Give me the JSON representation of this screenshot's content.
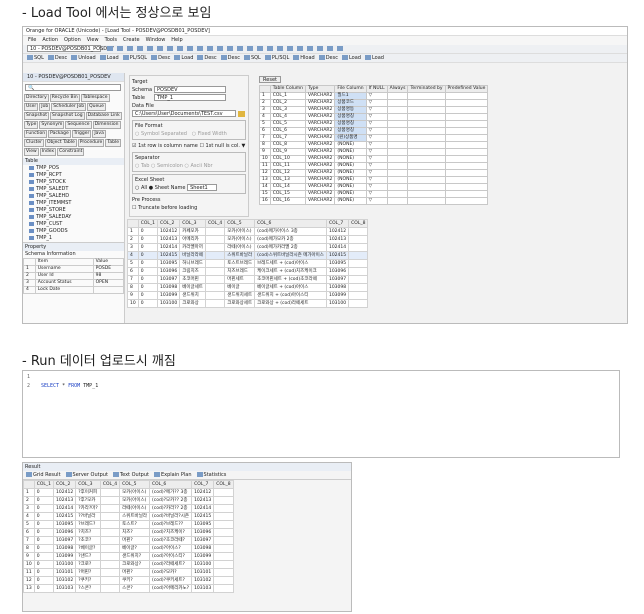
{
  "heading1": "- Load Tool 에서는 정상으로 보임",
  "heading2": "- Run 데이터 업로드시 깨짐",
  "app": {
    "title": "Orange for ORACLE (Unicode) - [Load Tool - POSDEV@POSDB01_POSDEV]",
    "menus": [
      "File",
      "Action",
      "Option",
      "View",
      "Tools",
      "Create",
      "Window",
      "Help"
    ],
    "connection": "10 - POSDEV@POSDB01_POSDEV",
    "toolbar_buttons": [
      "SQL",
      "Desc",
      "Unload",
      "Load",
      "PL/SQL",
      "Desc",
      "Load",
      "Desc",
      "Desc",
      "SQL",
      "PL/SQL",
      "Hload",
      "Desc",
      "Load",
      "Load"
    ],
    "conn_tab": "10 - POSDEV@POSDB01_POSDEV"
  },
  "browser": {
    "tabs": [
      "Directory",
      "Recycle Bin",
      "Tablespace",
      "User",
      "Job",
      "Scheduler Job",
      "Queue",
      "Snapshot",
      "Snapshot Log",
      "Database Link",
      "Type",
      "Synonym",
      "Sequence",
      "Dimension",
      "Function",
      "Package",
      "Trigger",
      "Java",
      "Cluster",
      "Object Table",
      "Procedure",
      "Table",
      "View",
      "Index",
      "Constraint"
    ],
    "section": "Table",
    "tree": [
      "TMP_POS",
      "TMP_RCPT",
      "TMP_STOCK",
      "TMP_SALEDT",
      "TMP_SALEHD",
      "TMP_ITEMMST",
      "TMP_STORE",
      "TMP_SALEDAY",
      "TMP_CUST",
      "TMP_GOODS",
      "TMP_1"
    ]
  },
  "property": {
    "title": "Property",
    "tab": "Schema Information",
    "headers": [
      "Item",
      "Value"
    ],
    "rows": [
      [
        "1",
        "Username",
        "POSDE"
      ],
      [
        "2",
        "User Id",
        "98"
      ],
      [
        "3",
        "Account Status",
        "OPEN"
      ],
      [
        "4",
        "Lock Date",
        ""
      ]
    ]
  },
  "load": {
    "target_label": "Target",
    "schema_label": "Schema",
    "schema_value": "POSDEV",
    "table_label": "Table",
    "table_value": "TMP_1",
    "datafile_label": "Data File",
    "datafile_value": "C:\\Users\\User\\Documents\\TEST.csv",
    "fileformat_label": "File Format",
    "delimited": "Symbol Separated",
    "fixed": "Fixed Width",
    "firstrow": "1st row is column name",
    "trailing": "1st null is col. ▼",
    "separator_label": "Separator",
    "sep_tab": "Tab",
    "sep_semicolon": "Semicolon",
    "sep_other": "Ascii Nbr",
    "excel_label": "Excel Sheet",
    "all": "All",
    "sheetname_label": "Sheet Name",
    "sheet_value": "Sheet1",
    "preproc_label": "Pre Process",
    "truncate": "Truncate before loading",
    "reset": "Reset"
  },
  "mapping": {
    "headers": [
      "",
      "Table Column",
      "Type",
      "File Column",
      "If NULL",
      "Always",
      "Terminated by",
      "Predefined Value"
    ],
    "rows": [
      [
        "1",
        "COL_1",
        "VARCHAR2",
        "필드1",
        "▽"
      ],
      [
        "2",
        "COL_2",
        "VARCHAR2",
        "상품코드",
        "▽"
      ],
      [
        "3",
        "COL_3",
        "VARCHAR2",
        "상품명등",
        "▽"
      ],
      [
        "4",
        "COL_4",
        "VARCHAR2",
        "상품명칭",
        "▽"
      ],
      [
        "5",
        "COL_5",
        "VARCHAR2",
        "상품명칭",
        "▽"
      ],
      [
        "6",
        "COL_6",
        "VARCHAR2",
        "상품명칭",
        "▽"
      ],
      [
        "7",
        "COL_7",
        "VARCHAR2",
        "(원)상품명",
        "▽"
      ],
      [
        "8",
        "COL_8",
        "VARCHAR2",
        "(NONE)",
        "▽"
      ],
      [
        "9",
        "COL_9",
        "VARCHAR2",
        "(NONE)",
        "▽"
      ],
      [
        "10",
        "COL_10",
        "VARCHAR2",
        "(NONE)",
        "▽"
      ],
      [
        "11",
        "COL_11",
        "VARCHAR2",
        "(NONE)",
        "▽"
      ],
      [
        "12",
        "COL_12",
        "VARCHAR2",
        "(NONE)",
        "▽"
      ],
      [
        "13",
        "COL_13",
        "VARCHAR2",
        "(NONE)",
        "▽"
      ],
      [
        "14",
        "COL_14",
        "VARCHAR2",
        "(NONE)",
        "▽"
      ],
      [
        "15",
        "COL_15",
        "VARCHAR2",
        "(NONE)",
        "▽"
      ],
      [
        "16",
        "COL_16",
        "VARCHAR2",
        "(NONE)",
        "▽"
      ]
    ]
  },
  "preview": {
    "headers": [
      "",
      "COL_1",
      "COL_2",
      "COL_3",
      "COL_4",
      "COL_5",
      "COL_6",
      "COL_7",
      "COL_8"
    ],
    "rows": [
      [
        "1",
        "0",
        "102412",
        "카페모카",
        "",
        "모카(아이스)",
        "(cod)메가아이스 3종",
        "102412",
        ""
      ],
      [
        "2",
        "0",
        "102413",
        "아메리카",
        "",
        "모카(아이스)",
        "(cod)메가모카 2종",
        "102413",
        ""
      ],
      [
        "3",
        "0",
        "102414",
        "카라멜마끼",
        "",
        "라떼(아이스)",
        "(cod)메가카라멜 2종",
        "102414",
        ""
      ],
      [
        "4",
        "0",
        "102415",
        "바닐라라떼",
        "",
        "스위트바닐라",
        "(cod)스위트바닐라시즌 메가아이스",
        "102415",
        ""
      ],
      [
        "5",
        "0",
        "103095",
        "허니브레드",
        "",
        "토스트브레드",
        "브레드세트 + (cod)아이스",
        "103095",
        ""
      ],
      [
        "6",
        "0",
        "103096",
        "크림치즈",
        "",
        "치즈브레드",
        "케이크세트 + (cod)치즈케이크",
        "103096",
        ""
      ],
      [
        "7",
        "0",
        "103097",
        "초코머핀",
        "",
        "머핀세트",
        "초코머핀세트 + (cod)초코라떼",
        "103097",
        ""
      ],
      [
        "8",
        "0",
        "103098",
        "베이글세트",
        "",
        "베이글",
        "베이글세트 + (cod)아이스",
        "103098",
        ""
      ],
      [
        "9",
        "0",
        "103099",
        "샌드위치",
        "",
        "샌드위치세트",
        "샌드위치 + (cod)아이스티",
        "103099",
        ""
      ],
      [
        "10",
        "0",
        "103100",
        "크로와상",
        "",
        "크로와상세트",
        "크로와상 + (cod)라떼세트",
        "103100",
        ""
      ]
    ]
  },
  "editor": {
    "lines": [
      {
        "n": "1",
        "text": ""
      },
      {
        "n": "2",
        "kw1": "SELECT",
        "star": " * ",
        "kw2": "FROM",
        "rest": " TMP_1"
      }
    ]
  },
  "result": {
    "title": "Result",
    "tabs": [
      "Grid Result",
      "Server Output",
      "Text Output",
      "Explain Plan",
      "Statistics"
    ],
    "headers": [
      "",
      "COL_1",
      "COL_2",
      "COL_3",
      "COL_4",
      "COL_5",
      "COL_6",
      "COL_7",
      "COL_8"
    ],
    "rows": [
      [
        "1",
        "0",
        "102412",
        "?후이커피",
        "",
        "모카(아이스)",
        "(cod)?메가?? 3종",
        "102412",
        ""
      ],
      [
        "2",
        "0",
        "102413",
        "?후?모카",
        "",
        "모카(아이스)",
        "(cod)?모카?? 2종",
        "102413",
        ""
      ],
      [
        "3",
        "0",
        "102414",
        "?카라?마?",
        "",
        "라떼(아이스)",
        "(cod)?카라?? 2종",
        "102414",
        ""
      ],
      [
        "4",
        "0",
        "102415",
        "??바닐라",
        "",
        "스위트바닐라",
        "(cod)?바닐라?시즌",
        "102415",
        ""
      ],
      [
        "5",
        "0",
        "103095",
        "?브레드?",
        "",
        "토스트?",
        "(cod)?브레드??",
        "103095",
        ""
      ],
      [
        "6",
        "0",
        "103096",
        "?치즈?",
        "",
        "치즈?",
        "(cod)?치즈케이?",
        "103096",
        ""
      ],
      [
        "7",
        "0",
        "103097",
        "?초코?",
        "",
        "머핀?",
        "(cod)?초코라떼?",
        "103097",
        ""
      ],
      [
        "8",
        "0",
        "103098",
        "?베이글?",
        "",
        "베이글?",
        "(cod)?아이스?",
        "103098",
        ""
      ],
      [
        "9",
        "0",
        "103099",
        "?샌드?",
        "",
        "샌드위치?",
        "(cod)?아이스티?",
        "103099",
        ""
      ],
      [
        "10",
        "0",
        "103100",
        "?크로?",
        "",
        "크로와상?",
        "(cod)?라떼세트?",
        "103100",
        ""
      ],
      [
        "11",
        "0",
        "103101",
        "?머핀?",
        "",
        "머핀?",
        "(cod)?모카?",
        "103101",
        ""
      ],
      [
        "12",
        "0",
        "103102",
        "?쿠키?",
        "",
        "쿠키?",
        "(cod)?쿠키세트?",
        "103102",
        ""
      ],
      [
        "13",
        "0",
        "103103",
        "?스콘?",
        "",
        "스콘?",
        "(cod)?아메리카노?",
        "103103",
        ""
      ]
    ]
  }
}
